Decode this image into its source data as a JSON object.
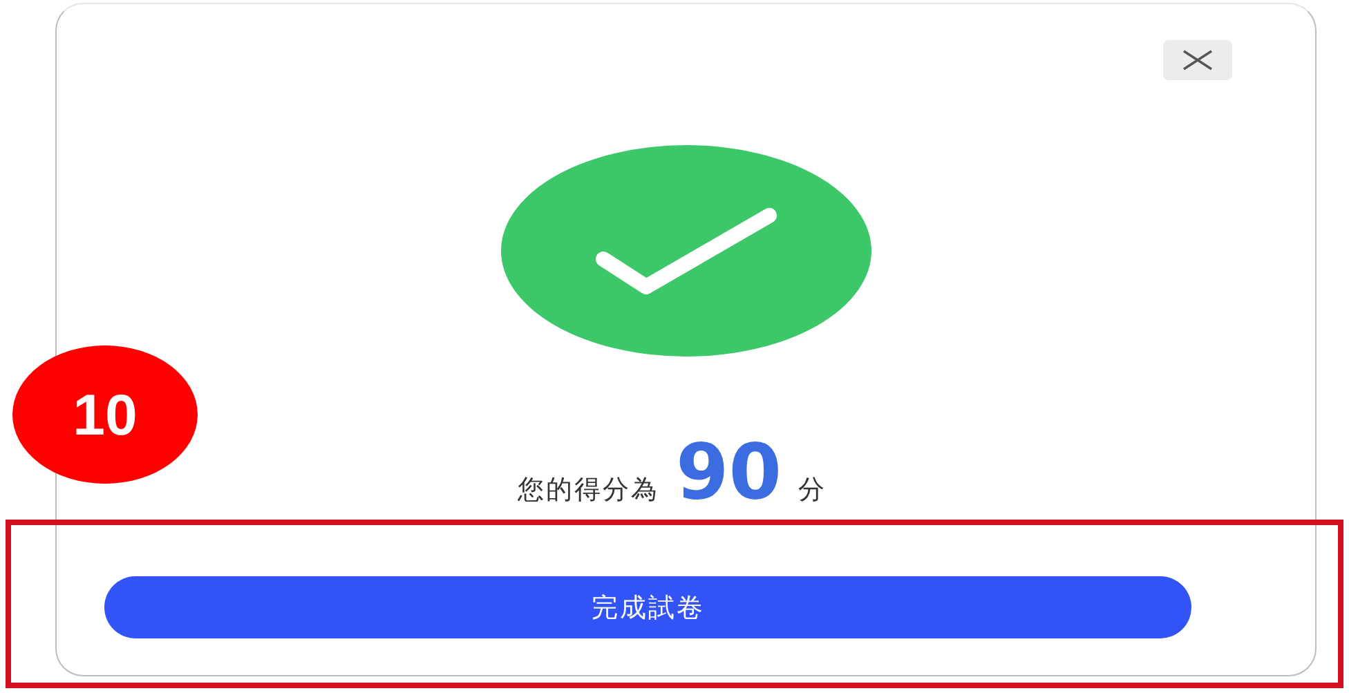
{
  "dialog": {
    "score_label": "您的得分為",
    "score": "90",
    "score_unit": "分",
    "button": "完成試卷"
  },
  "annotation": {
    "step": "10"
  }
}
